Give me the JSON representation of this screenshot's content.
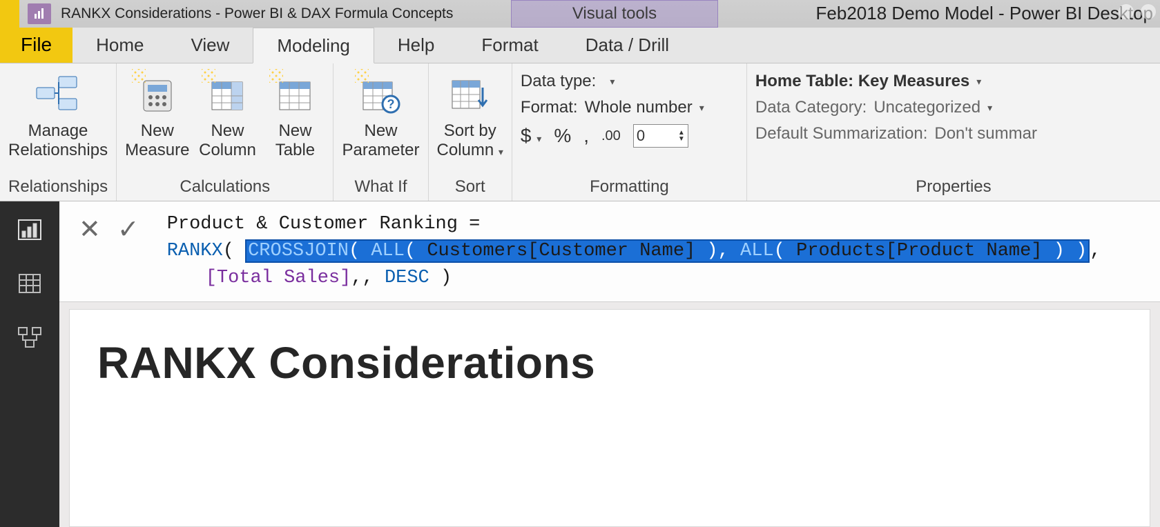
{
  "titlebar": {
    "video_title": "RANKX Considerations - Power BI & DAX Formula Concepts",
    "visual_tools": "Visual tools",
    "doc_title": "Feb2018 Demo Model - Power BI Desktop"
  },
  "tabs": {
    "file": "File",
    "home": "Home",
    "view": "View",
    "modeling": "Modeling",
    "help": "Help",
    "format": "Format",
    "data_drill": "Data / Drill",
    "active": "modeling"
  },
  "ribbon": {
    "relationships": {
      "manage": "Manage\nRelationships",
      "group": "Relationships"
    },
    "calculations": {
      "new_measure": "New\nMeasure",
      "new_column": "New\nColumn",
      "new_table": "New\nTable",
      "group": "Calculations"
    },
    "whatif": {
      "new_parameter": "New\nParameter",
      "group": "What If"
    },
    "sort": {
      "sort_by_column": "Sort by\nColumn",
      "group": "Sort"
    },
    "formatting": {
      "data_type_label": "Data type:",
      "data_type_value": "",
      "format_label": "Format:",
      "format_value": "Whole number",
      "currency": "$",
      "percent": "%",
      "thousands": ",",
      "decimals_icon": ".00",
      "decimals_value": "0",
      "group": "Formatting"
    },
    "properties": {
      "home_table_label": "Home Table:",
      "home_table_value": "Key Measures",
      "data_category_label": "Data Category:",
      "data_category_value": "Uncategorized",
      "default_summarization_label": "Default Summarization:",
      "default_summarization_value": "Don't summar",
      "group": "Properties"
    }
  },
  "formula": {
    "measure_name": "Product & Customer Ranking",
    "rankx": "RANKX",
    "crossjoin": "CROSSJOIN",
    "all1": "ALL",
    "col1": "Customers[Customer Name]",
    "all2": "ALL",
    "col2": "Products[Product Name]",
    "total_sales": "[Total Sales]",
    "desc": "DESC"
  },
  "canvas": {
    "heading": "RANKX Considerations"
  }
}
